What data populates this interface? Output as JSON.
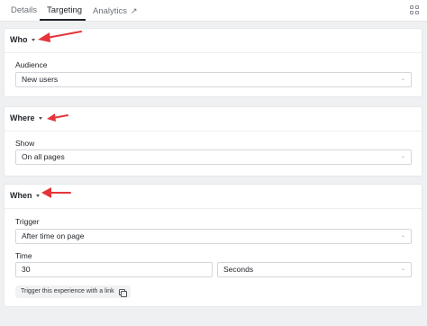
{
  "tabs": [
    {
      "label": "Details"
    },
    {
      "label": "Targeting"
    },
    {
      "label": "Analytics",
      "external_icon": "↗"
    }
  ],
  "sections": {
    "who": {
      "title": "Who",
      "audience_label": "Audience",
      "audience_value": "New users"
    },
    "where": {
      "title": "Where",
      "show_label": "Show",
      "show_value": "On all pages"
    },
    "when": {
      "title": "When",
      "trigger_label": "Trigger",
      "trigger_value": "After time on page",
      "time_label": "Time",
      "time_value": "30",
      "unit_value": "Seconds",
      "link_button_label": "Trigger this experience with a link"
    }
  },
  "icons": {
    "chevron": "⌄",
    "annotation_color": "#e5343a"
  }
}
